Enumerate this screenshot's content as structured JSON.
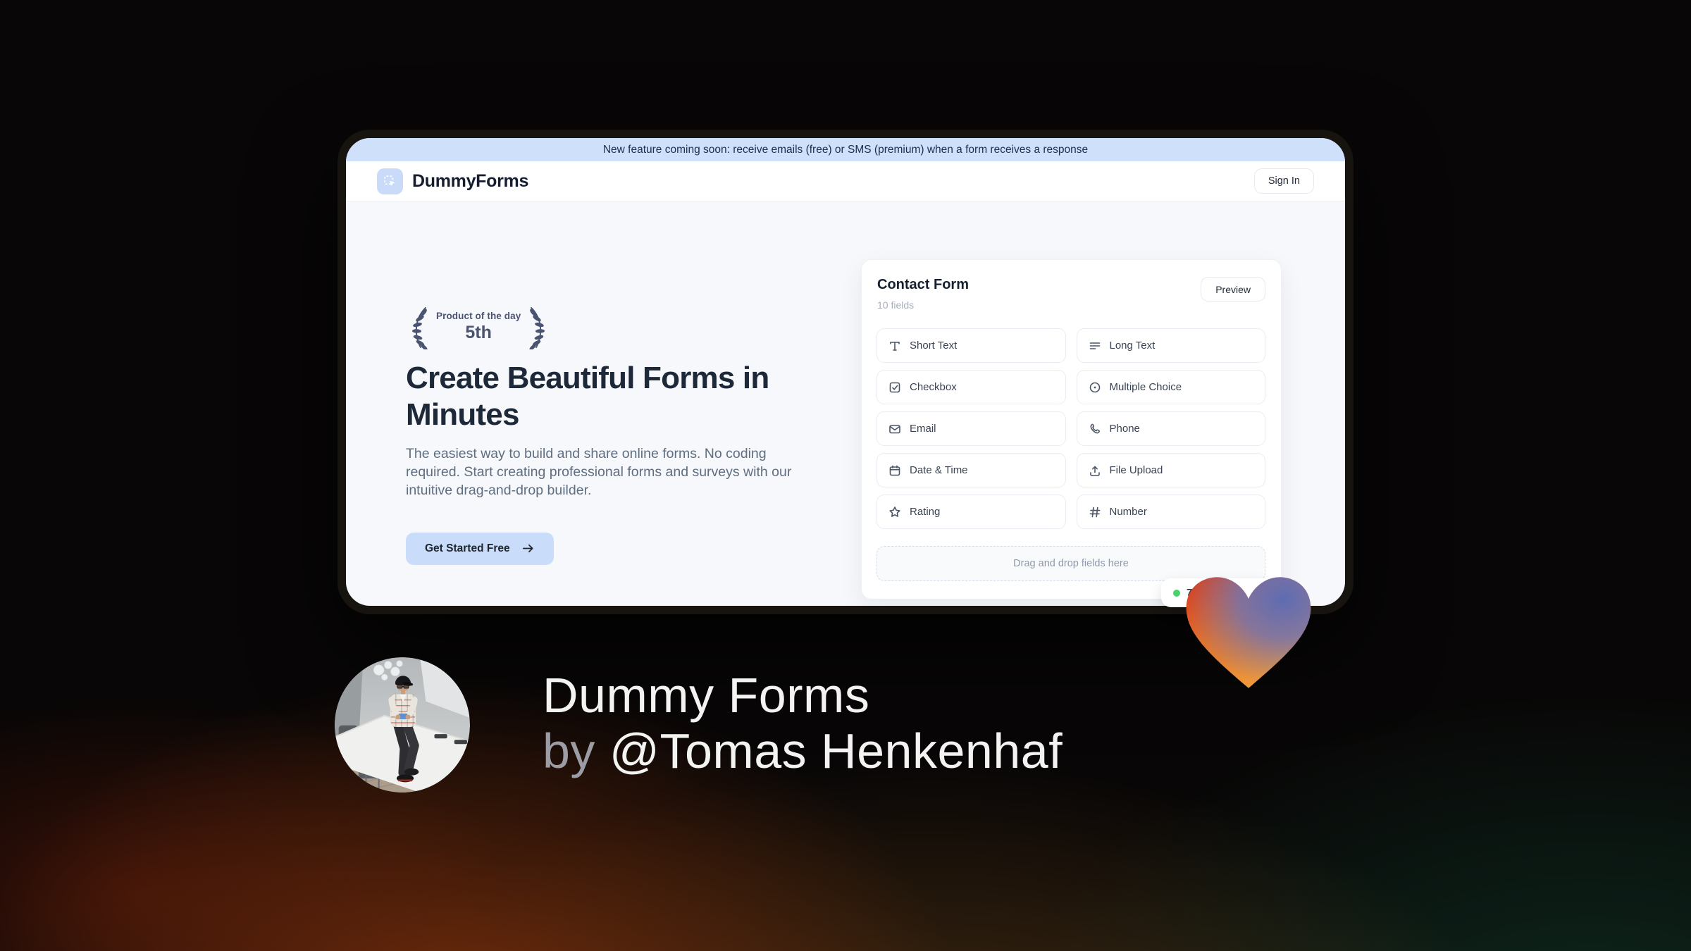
{
  "banner": {
    "text": "New feature coming soon: receive emails (free) or SMS (premium) when a form receives a response"
  },
  "header": {
    "brand": "DummyForms",
    "sign_in_label": "Sign In"
  },
  "hero": {
    "award_label": "Product of the day",
    "award_rank": "5th",
    "title": "Create Beautiful Forms in Minutes",
    "description": "The easiest way to build and share online forms. No coding required. Start creating professional forms and surveys with our intuitive drag-and-drop builder.",
    "cta_label": "Get Started Free"
  },
  "form_builder": {
    "title": "Contact Form",
    "subtitle": "10 fields",
    "preview_label": "Preview",
    "fields": [
      {
        "label": "Short Text",
        "icon": "short-text-icon"
      },
      {
        "label": "Long Text",
        "icon": "long-text-icon"
      },
      {
        "label": "Checkbox",
        "icon": "checkbox-icon"
      },
      {
        "label": "Multiple Choice",
        "icon": "radio-icon"
      },
      {
        "label": "Email",
        "icon": "envelope-icon"
      },
      {
        "label": "Phone",
        "icon": "phone-icon"
      },
      {
        "label": "Date & Time",
        "icon": "calendar-icon"
      },
      {
        "label": "File Upload",
        "icon": "upload-icon"
      },
      {
        "label": "Rating",
        "icon": "star-icon"
      },
      {
        "label": "Number",
        "icon": "hash-icon"
      }
    ],
    "dropzone_text": "Drag and drop fields here",
    "status_badge": {
      "visible_text": "7",
      "dot_color": "#4cd26b"
    }
  },
  "author": {
    "title": "Dummy Forms",
    "byline_prefix": "by",
    "byline_handle": "@Tomas Henkenhaf"
  },
  "colors": {
    "banner_bg": "#cfe0fb",
    "logo_tile": "#c9dbf8",
    "cta_bg": "#c9ddfa",
    "laurel": "#4a5471",
    "status_green": "#4cd26b",
    "heart_red": "#d8381d",
    "heart_orange": "#f2a43e",
    "heart_blue": "#5e6cb2"
  }
}
